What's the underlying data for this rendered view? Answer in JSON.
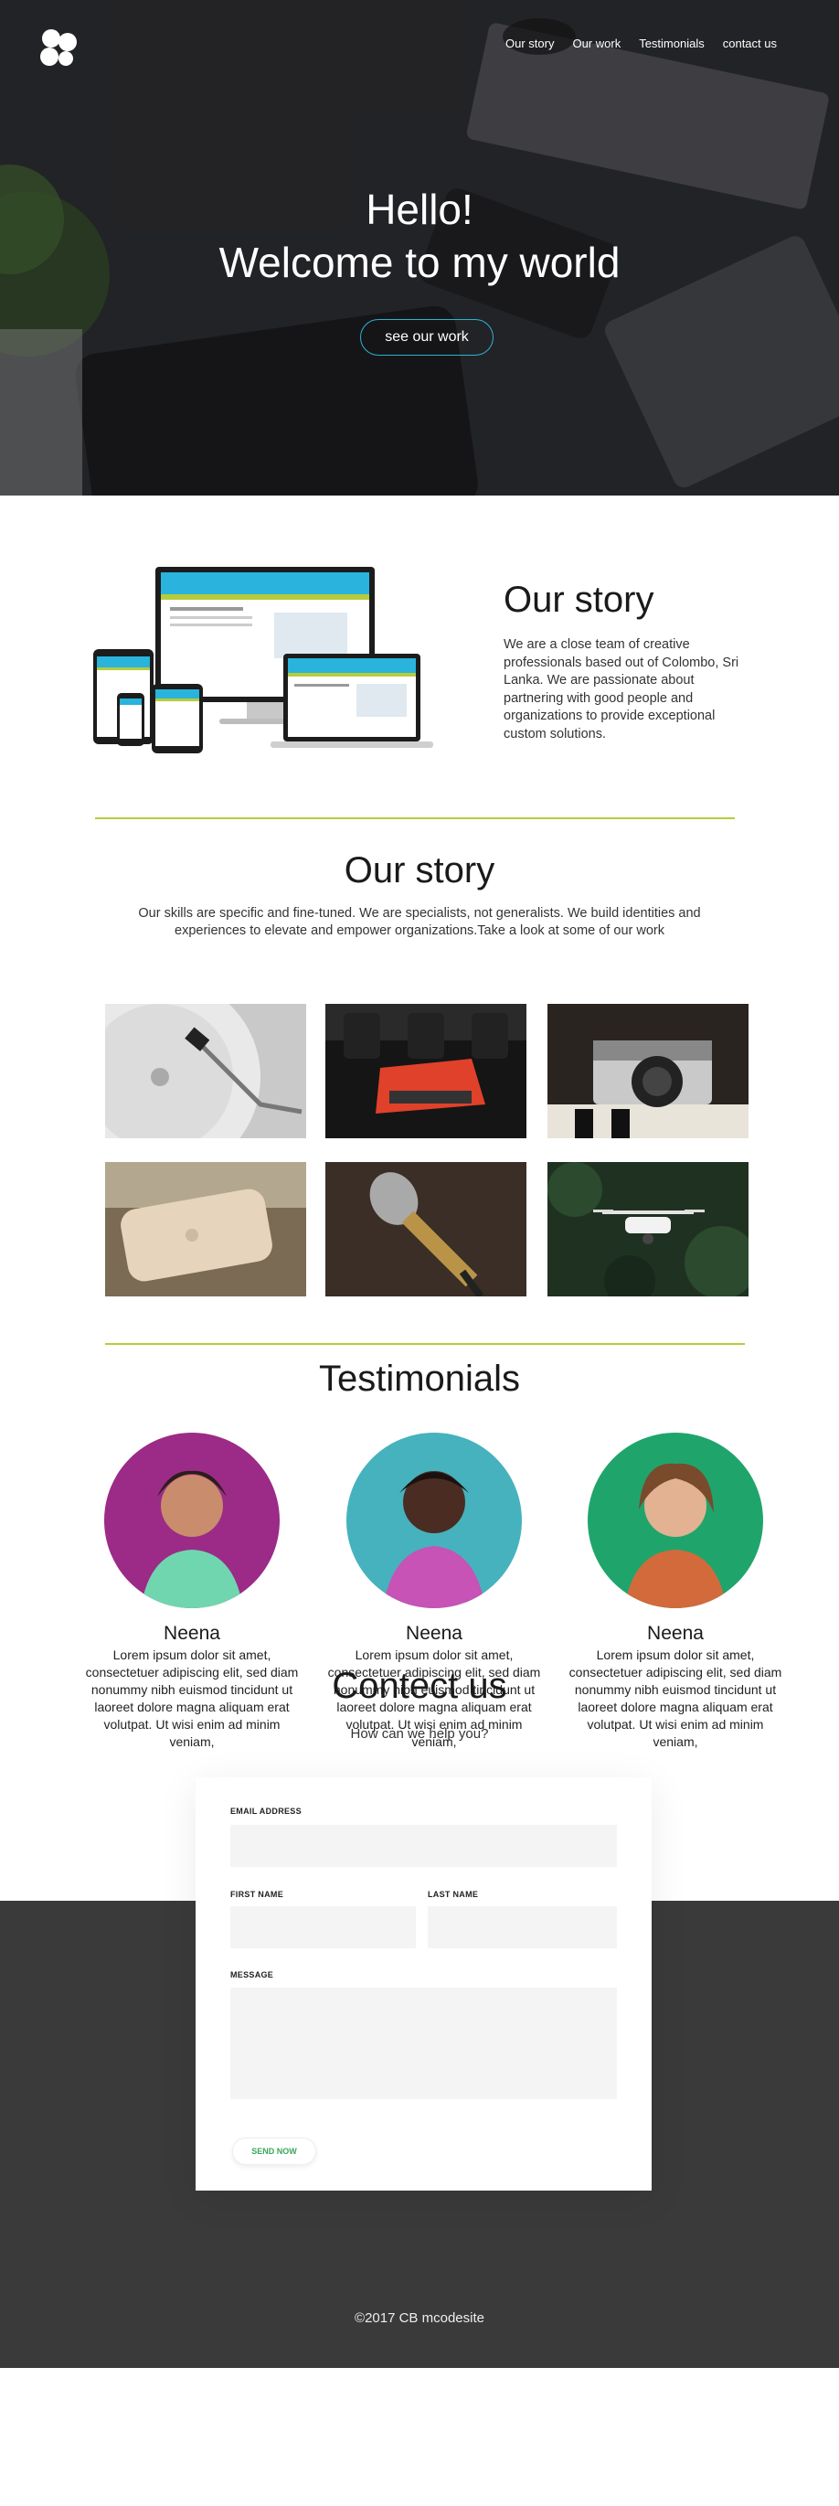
{
  "nav": {
    "items": [
      "Our story",
      "Our work",
      "Testimonials",
      "contact us"
    ]
  },
  "hero": {
    "title_line1": "Hello!",
    "title_line2": "Welcome to my world",
    "button": "see our work"
  },
  "story_one": {
    "heading": "Our story",
    "body": "We are a close team of creative professionals based out of Colombo, Sri Lanka. We are passionate about partnering with good people and organizations to provide exceptional custom solutions."
  },
  "story_two": {
    "heading": "Our story",
    "intro": "Our skills are specific and fine-tuned. We are specialists, not generalists. We build identities and experiences to elevate and empower organizations.Take a look at some of our work",
    "works": [
      {
        "icon": "turntable-icon"
      },
      {
        "icon": "typewriter-icon"
      },
      {
        "icon": "camera-icon"
      },
      {
        "icon": "phone-icon"
      },
      {
        "icon": "microphone-icon"
      },
      {
        "icon": "drone-icon"
      }
    ]
  },
  "testimonials": {
    "heading": "Testimonials",
    "people": [
      {
        "name": "Neena",
        "quote": "Lorem ipsum dolor sit amet, consectetuer adipiscing elit, sed diam nonummy nibh euismod tincidunt ut laoreet dolore magna aliquam erat volutpat. Ut wisi enim ad minim veniam,",
        "bg": "#9b2b86"
      },
      {
        "name": "Neena",
        "quote": "Lorem ipsum dolor sit amet, consectetuer adipiscing elit, sed diam nonummy nibh euismod tincidunt ut laoreet dolore magna aliquam erat volutpat. Ut wisi enim ad minim veniam,",
        "bg": "#46b2bd"
      },
      {
        "name": "Neena",
        "quote": "Lorem ipsum dolor sit amet, consectetuer adipiscing elit, sed diam nonummy nibh euismod tincidunt ut laoreet dolore magna aliquam erat volutpat. Ut wisi enim ad minim veniam,",
        "bg": "#1fa56c"
      }
    ]
  },
  "contact": {
    "heading": "Contect us",
    "subheading": "How can we help you?",
    "email_label": "EMAIL ADDRESS",
    "first_name_label": "FIRST NAME",
    "last_name_label": "LAST NAME",
    "message_label": "MESSAGE",
    "send_label": "SEND NOW"
  },
  "footer": {
    "text": "©2017 CB mcodesite"
  },
  "colors": {
    "accent_rule": "#b6cc3a",
    "button_border": "#2bb3d6",
    "send_text": "#3aa65a",
    "footer_bg": "#3a3a3b"
  }
}
